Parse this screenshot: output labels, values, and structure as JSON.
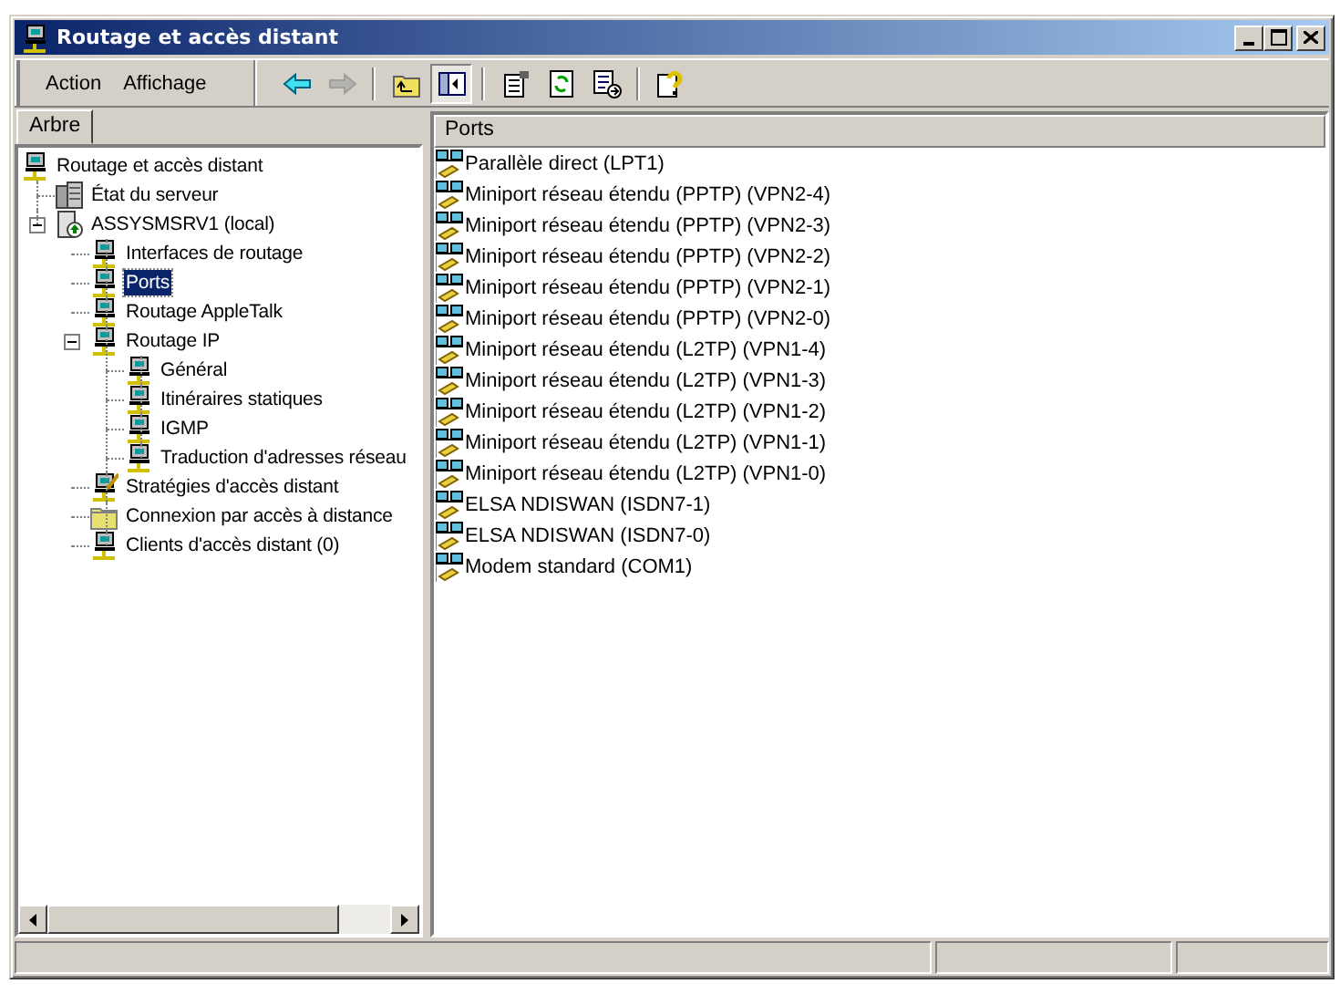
{
  "window": {
    "title": "Routage et accès distant"
  },
  "menu": [
    {
      "label": "Action"
    },
    {
      "label": "Affichage"
    }
  ],
  "toolbar": [
    {
      "kind": "back",
      "disabled": false,
      "pressed": false
    },
    {
      "kind": "forward",
      "disabled": true,
      "pressed": false
    },
    {
      "kind": "up",
      "disabled": false,
      "pressed": false
    },
    {
      "kind": "tree",
      "disabled": false,
      "pressed": true
    },
    {
      "kind": "properties",
      "disabled": false,
      "pressed": false
    },
    {
      "kind": "refresh",
      "disabled": false,
      "pressed": false
    },
    {
      "kind": "export",
      "disabled": false,
      "pressed": false
    },
    {
      "kind": "help",
      "disabled": false,
      "pressed": false
    }
  ],
  "tree_tab": {
    "label": "Arbre"
  },
  "tree": [
    {
      "label": "Routage et accès distant",
      "kind": "computer",
      "selected": false,
      "children": [
        {
          "label": "État du serveur",
          "kind": "servers",
          "selected": false
        },
        {
          "label": "ASSYSMSRV1 (local)",
          "kind": "server",
          "selected": false,
          "expanded": true,
          "children": [
            {
              "label": "Interfaces de routage",
              "kind": "computer",
              "selected": false
            },
            {
              "label": "Ports",
              "kind": "computer",
              "selected": true
            },
            {
              "label": "Routage AppleTalk",
              "kind": "computer",
              "selected": false
            },
            {
              "label": "Routage IP",
              "kind": "computer",
              "selected": false,
              "expanded": true,
              "children": [
                {
                  "label": "Général",
                  "kind": "computer",
                  "selected": false
                },
                {
                  "label": "Itinéraires statiques",
                  "kind": "computer",
                  "selected": false
                },
                {
                  "label": "IGMP",
                  "kind": "computer",
                  "selected": false
                },
                {
                  "label": "Traduction d'adresses réseau",
                  "kind": "computer",
                  "selected": false
                }
              ]
            },
            {
              "label": "Stratégies d'accès distant",
              "kind": "policy",
              "selected": false
            },
            {
              "label": "Connexion par accès à distance",
              "kind": "folder",
              "selected": false
            },
            {
              "label": "Clients d'accès distant (0)",
              "kind": "computer",
              "selected": false
            }
          ]
        }
      ]
    }
  ],
  "list": {
    "header": "Ports",
    "items": [
      {
        "label": "Parallèle direct (LPT1)"
      },
      {
        "label": "Miniport réseau étendu (PPTP) (VPN2-4)"
      },
      {
        "label": "Miniport réseau étendu (PPTP) (VPN2-3)"
      },
      {
        "label": "Miniport réseau étendu (PPTP) (VPN2-2)"
      },
      {
        "label": "Miniport réseau étendu (PPTP) (VPN2-1)"
      },
      {
        "label": "Miniport réseau étendu (PPTP) (VPN2-0)"
      },
      {
        "label": "Miniport réseau étendu (L2TP) (VPN1-4)"
      },
      {
        "label": "Miniport réseau étendu (L2TP) (VPN1-3)"
      },
      {
        "label": "Miniport réseau étendu (L2TP) (VPN1-2)"
      },
      {
        "label": "Miniport réseau étendu (L2TP) (VPN1-1)"
      },
      {
        "label": "Miniport réseau étendu (L2TP) (VPN1-0)"
      },
      {
        "label": "ELSA NDISWAN (ISDN7-1)"
      },
      {
        "label": "ELSA NDISWAN (ISDN7-0)"
      },
      {
        "label": "Modem standard (COM1)"
      }
    ]
  }
}
